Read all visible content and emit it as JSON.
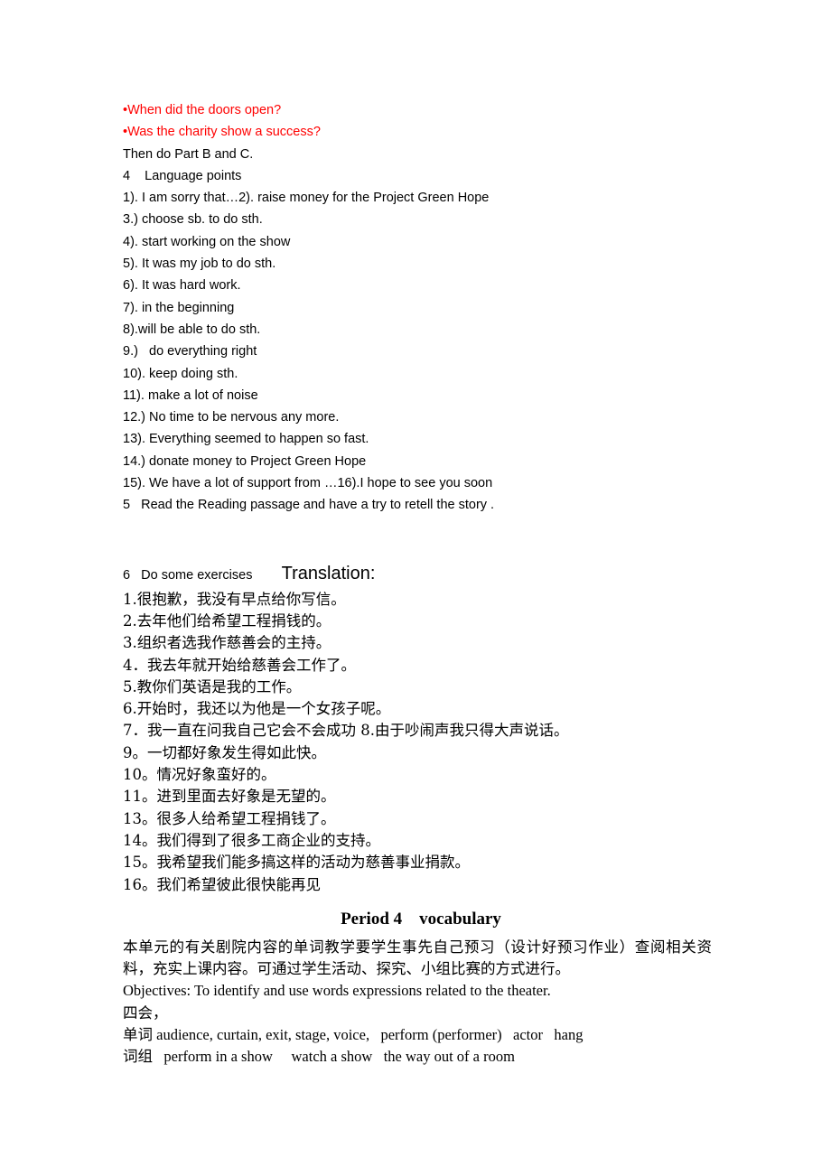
{
  "document": {
    "lesson_notes": {
      "bullets": [
        "•When did the doors open?",
        "•Was the charity show a success?"
      ],
      "bullet_color": "#ff0000",
      "then_line": "Then do Part B and C.",
      "section_4_heading": "4    Language points",
      "language_points": [
        "1). I am sorry that…2). raise money for the Project Green Hope",
        "3.) choose sb. to do sth.",
        "4). start working on the show",
        "5). It was my job to do sth.",
        "6). It was hard work.",
        "7). in the beginning",
        "8).will be able to do sth.",
        "9.)   do everything right",
        "10). keep doing sth.",
        "11). make a lot of noise",
        "12.) No time to be nervous any more.",
        "13). Everything seemed to happen so fast.",
        "14.) donate money to Project Green Hope",
        "15). We have a lot of support from …16).I hope to see you soon"
      ],
      "section_5_heading": "5   Read the Reading passage and have a try to retell the story ."
    },
    "exercises": {
      "heading": "6   Do some exercises        ",
      "translation_label": "Translation:",
      "sentences": [
        "1.很抱歉，我没有早点给你写信。",
        "2.去年他们给希望工程捐钱的。",
        "3.组织者选我作慈善会的主持。",
        "4．我去年就开始给慈善会工作了。",
        "5.教你们英语是我的工作。",
        "6.开始时，我还以为他是一个女孩子呢。",
        "7．我一直在问我自己它会不会成功 8.由于吵闹声我只得大声说话。",
        "9。一切都好象发生得如此快。",
        "10。情况好象蛮好的。",
        "11。进到里面去好象是无望的。",
        "13。很多人给希望工程捐钱了。",
        "14。我们得到了很多工商企业的支持。",
        "15。我希望我们能多搞这样的活动为慈善事业捐款。",
        "16。我们希望彼此很快能再见"
      ]
    },
    "period4": {
      "heading": "Period 4    vocabulary",
      "intro_paragraph": "本单元的有关剧院内容的单词教学要学生事先自己预习（设计好预习作业）查阅相关资料，充实上课内容。可通过学生活动、探究、小组比赛的方式进行。",
      "objectives": "Objectives: To identify and use words expressions related to the theater.",
      "four_skills_label": "四会，",
      "words_label": "单词",
      "words_list": " audience, curtain, exit, stage, voice,   perform (performer)   actor   hang",
      "phrases_label": "词组",
      "phrases_list": "   perform in a show     watch a show   the way out of a room"
    }
  }
}
